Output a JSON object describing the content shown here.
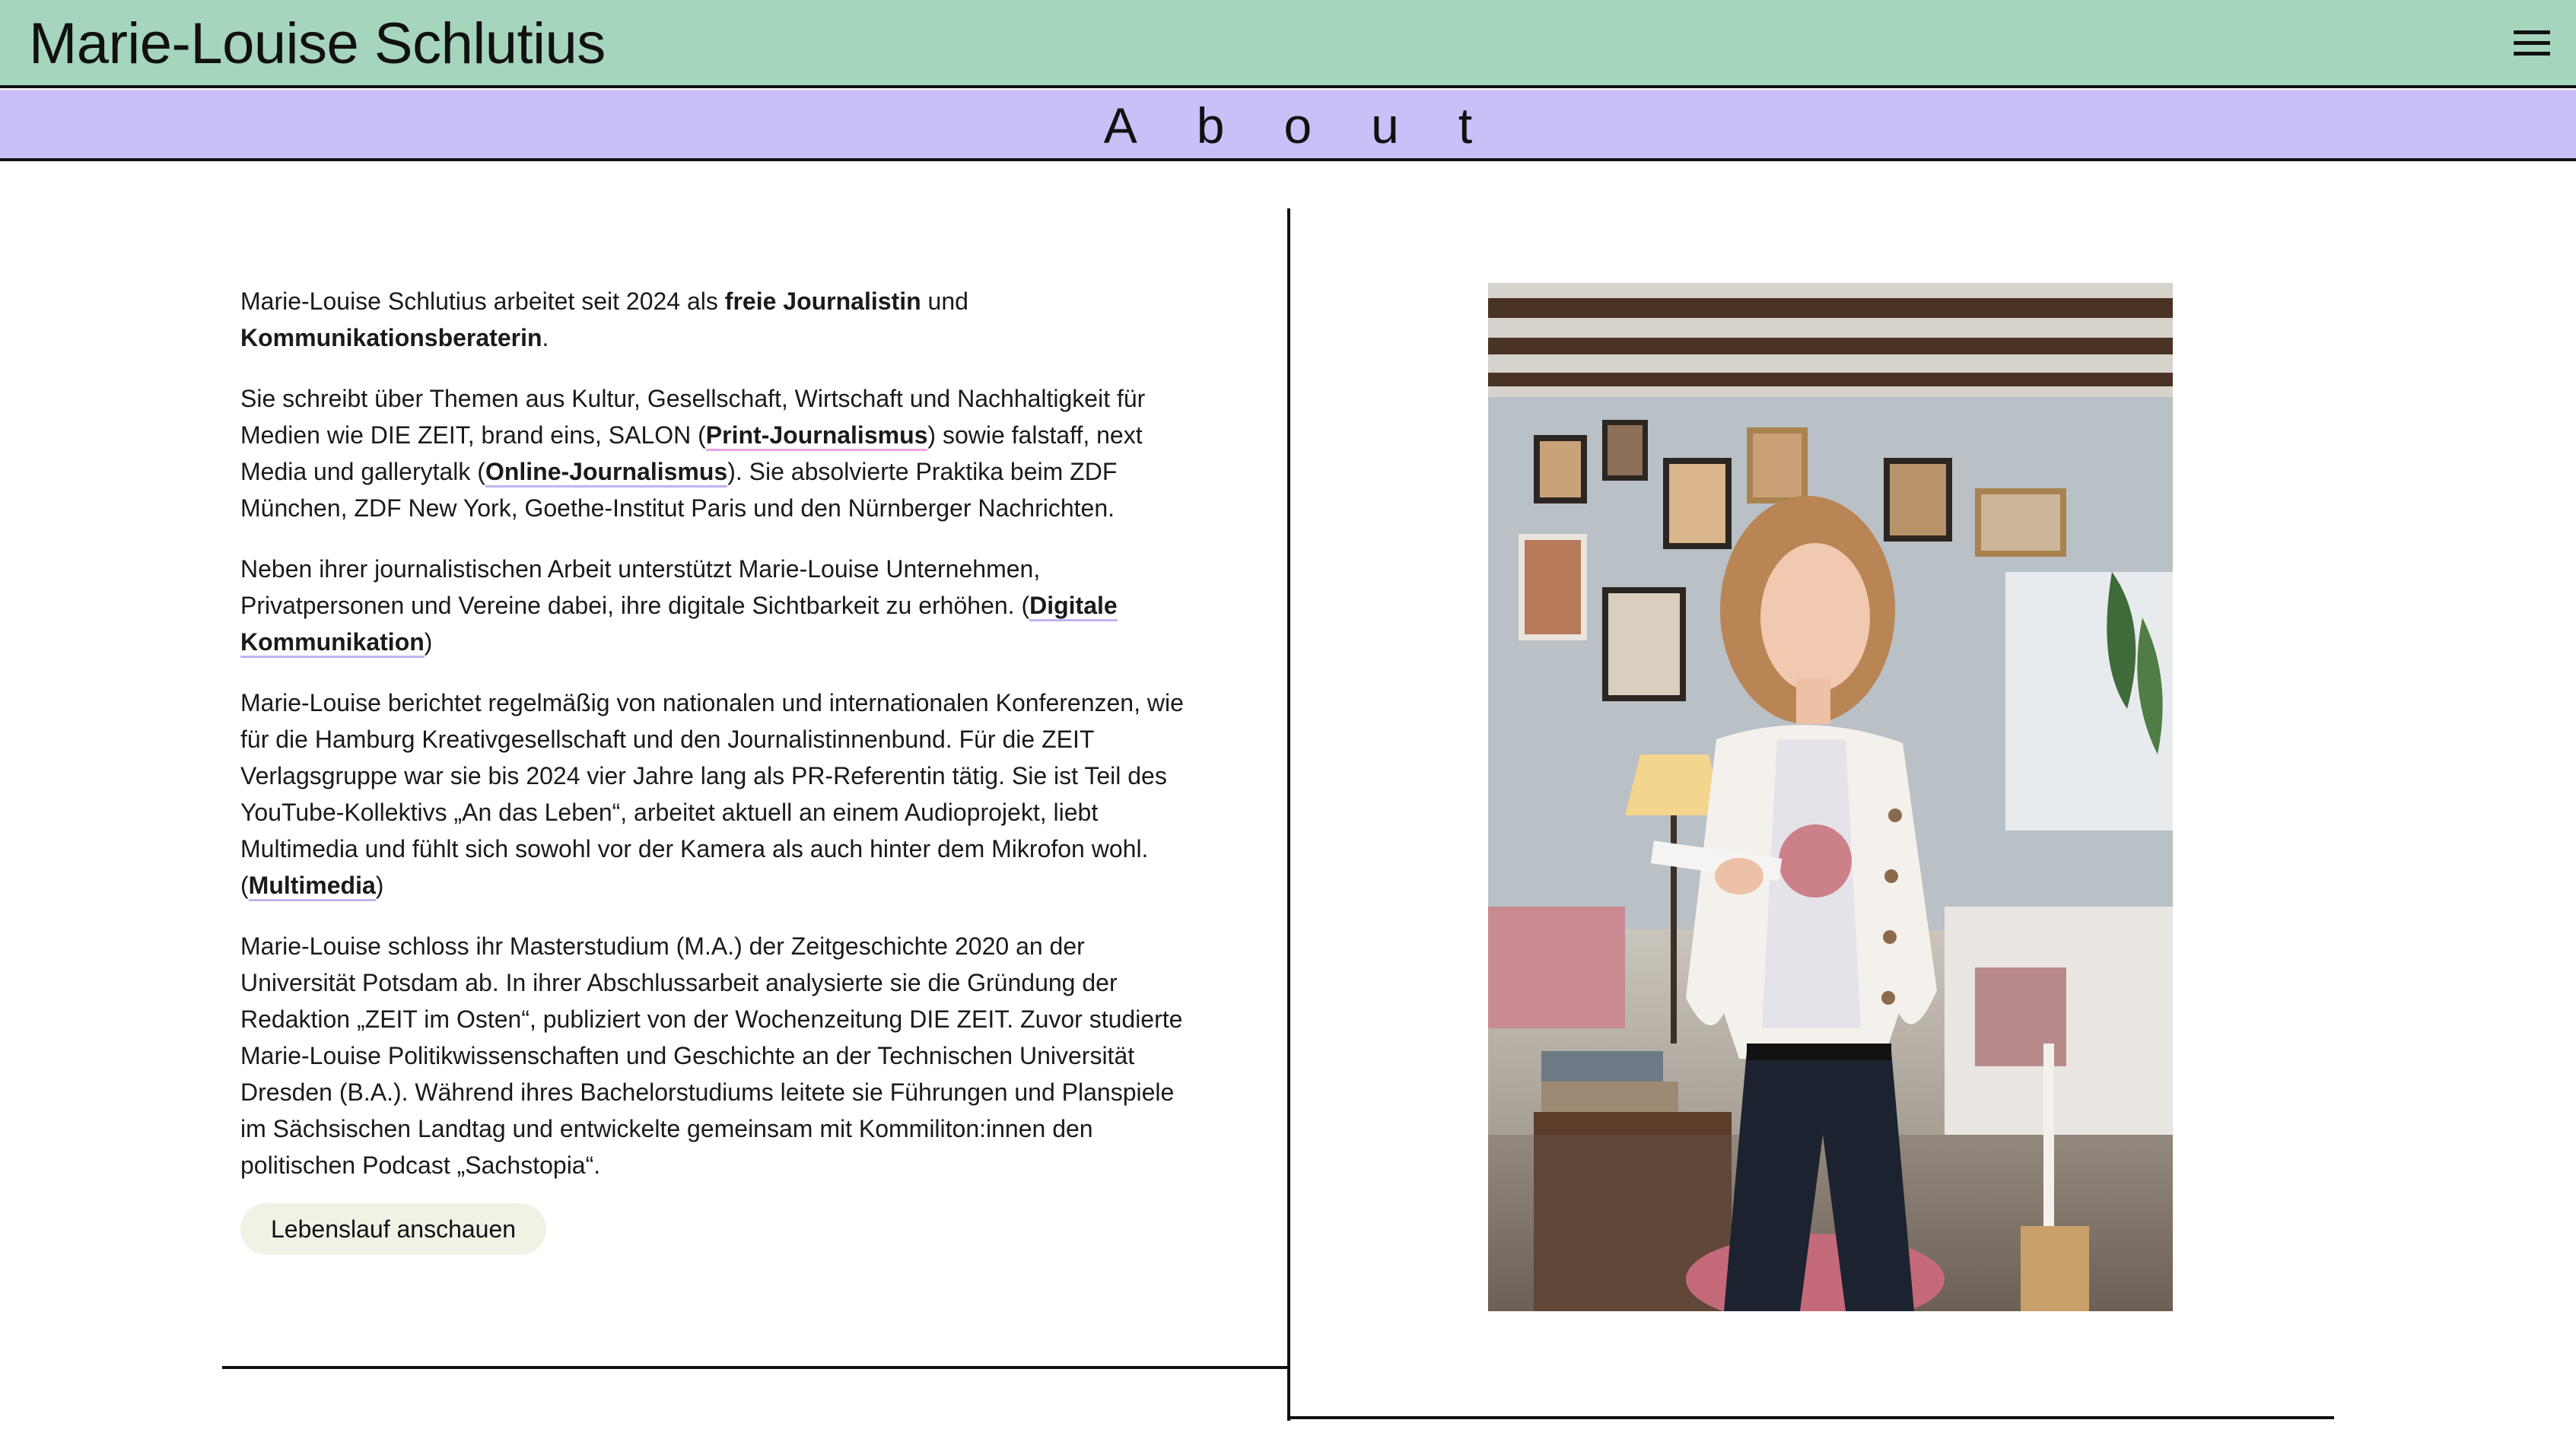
{
  "header": {
    "site_title": "Marie-Louise Schlutius",
    "menu_icon": "hamburger-menu-icon"
  },
  "banner": {
    "title": "About"
  },
  "about": {
    "p1": {
      "t1": "Marie-Louise Schlutius arbeitet seit 2024 als ",
      "b1": "freie Journalistin",
      "t2": " und ",
      "b2": "Kommunikationsberaterin",
      "t3": "."
    },
    "p2": {
      "t1": "Sie schreibt über Themen aus Kultur, Gesellschaft, Wirtschaft und Nachhaltigkeit für Medien wie DIE ZEIT, brand eins, SALON (",
      "link1": "Print-Journalismus",
      "t2": ") sowie falstaff, next Media und gallerytalk (",
      "link2": "Online-Journalismus",
      "t3": "). Sie absolvierte Praktika beim ZDF München, ZDF New York, Goethe-Institut Paris und den Nürnberger Nachrichten."
    },
    "p3": {
      "t1": "Neben ihrer journalistischen Arbeit unterstützt Marie-Louise Unternehmen, Privatpersonen und Vereine dabei, ihre digitale Sichtbarkeit zu erhöhen. (",
      "link1": "Digitale Kommunikation",
      "t2": ")"
    },
    "p4": {
      "t1": "Marie-Louise berichtet regelmäßig von nationalen und internationalen Konferenzen, wie für die Hamburg Kreativgesellschaft und den Journalistinnenbund. Für die ZEIT Verlagsgruppe war sie bis 2024 vier Jahre lang als PR-Referentin tätig. Sie ist Teil des YouTube-Kollektivs „An das Leben“, arbeitet aktuell an einem Audioprojekt, liebt Multimedia und fühlt sich sowohl vor der Kamera als auch hinter dem Mikrofon wohl. (",
      "link1": "Multimedia",
      "t2": ")"
    },
    "p5": "Marie-Louise schloss ihr Masterstudium (M.A.) der Zeitgeschichte 2020 an der Universität Potsdam ab. In ihrer Abschlussarbeit analysierte sie die Gründung der Redaktion „ZEIT im Osten“, publiziert von der Wochenzeitung DIE ZEIT. Zuvor studierte Marie-Louise Politikwissenschaften und Geschichte an der Technischen Universität Dresden (B.A.). Während ihres Bachelorstudiums leitete sie Führungen und Planspiele im Sächsischen Landtag und entwickelte gemeinsam mit Kommiliton:innen den politischen Podcast „Sachstopia“.",
    "cv_button": "Lebenslauf anschauen"
  },
  "colors": {
    "header_bg": "#a6d5bd",
    "banner_bg": "#cbbff8",
    "link_underline": "#c3b2f2",
    "link_underline_alt": "#e7a5dc",
    "button_bg": "#f2f1e6"
  }
}
